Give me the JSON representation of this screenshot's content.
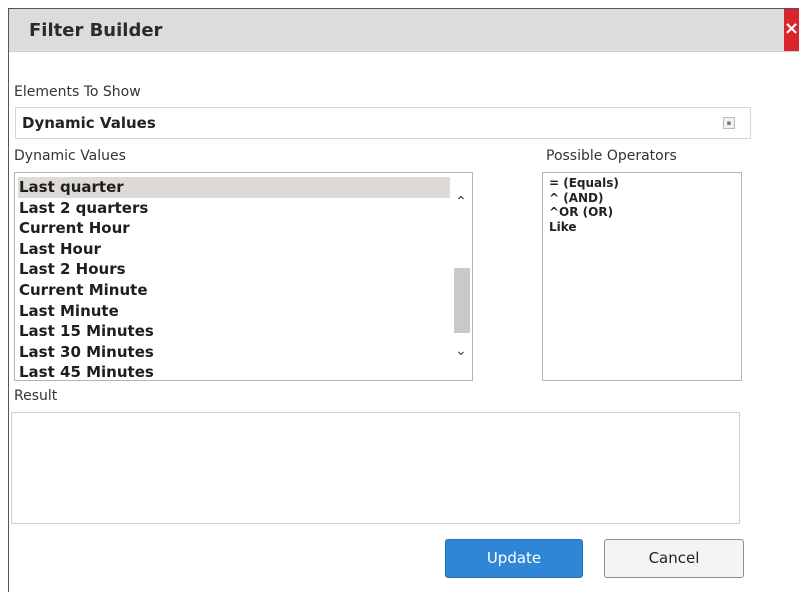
{
  "dialog": {
    "title": "Filter Builder",
    "close_label": "×"
  },
  "elements_to_show": {
    "label": "Elements To Show",
    "selected_value": "Dynamic Values",
    "arrow_glyph": "▪"
  },
  "dynamic_values": {
    "label": "Dynamic Values",
    "items": [
      {
        "label": "Last quarter",
        "selected": true
      },
      {
        "label": "Last 2 quarters",
        "selected": false
      },
      {
        "label": "Current Hour",
        "selected": false
      },
      {
        "label": "Last Hour",
        "selected": false
      },
      {
        "label": "Last 2 Hours",
        "selected": false
      },
      {
        "label": "Current Minute",
        "selected": false
      },
      {
        "label": "Last Minute",
        "selected": false
      },
      {
        "label": "Last 15 Minutes",
        "selected": false
      },
      {
        "label": "Last 30 Minutes",
        "selected": false
      },
      {
        "label": "Last 45 Minutes",
        "selected": false
      }
    ]
  },
  "possible_operators": {
    "label": "Possible Operators",
    "items": [
      "= (Equals)",
      "^ (AND)",
      "^OR (OR)",
      "Like"
    ]
  },
  "result": {
    "label": "Result",
    "value": ""
  },
  "buttons": {
    "update_label": "Update",
    "cancel_label": "Cancel"
  },
  "colors": {
    "titlebar": "#dcdcdc",
    "close": "#d9262c",
    "update_button": "#2f86d6",
    "selected_row": "#dedad6"
  }
}
